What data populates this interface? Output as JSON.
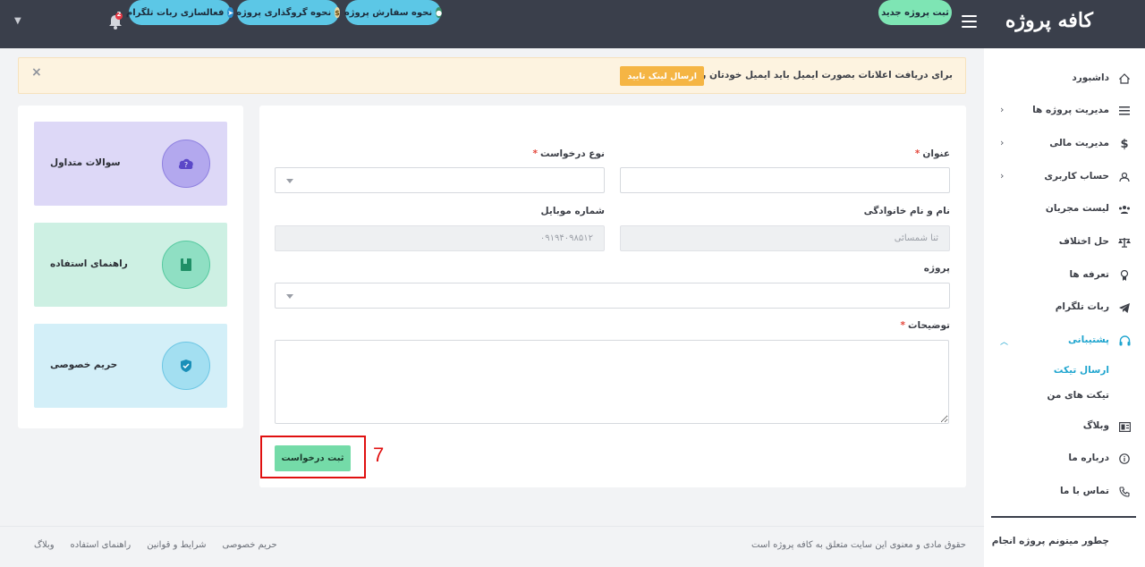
{
  "header": {
    "logo": "کافه پروژه",
    "new_project_label": "ثبت پروژه جدید",
    "how_to_order_label": "نحوه سفارش پروژه",
    "how_to_post_label": "نحوه گروگذاری پروژه",
    "telegram_bot_label": "فعالسازی ربات تلگرام",
    "notification_count": "2"
  },
  "alert": {
    "message": "برای دریافت اعلانات بصورت ایمیل باید ایمیل خودتان را تایید کنید.",
    "button_label": "ارسال لینک تایید",
    "close_symbol": "×"
  },
  "form": {
    "title_label": "عنوان",
    "type_label": "نوع درخواست",
    "name_label": "نام و نام خانوادگی",
    "name_value": "ثنا شمسائی",
    "mobile_label": "شماره موبایل",
    "mobile_value": "۰۹۱۹۴۰۹۸۵۱۲",
    "project_label": "پروژه",
    "description_label": "توضیحات",
    "required_mark": "*",
    "submit_label": "ثبت درخواست"
  },
  "annotation": {
    "number": "7",
    "color": "#e01010"
  },
  "widgets": [
    {
      "title": "سوالات متداول",
      "bg": "#ddd8f7",
      "circle": "#b3a8ee",
      "icon": "cloud-question-icon"
    },
    {
      "title": "راهنمای استفاده",
      "bg": "#cdf0e3",
      "circle": "#8fdfc3",
      "icon": "book-icon"
    },
    {
      "title": "حریم خصوصی",
      "bg": "#d3eff8",
      "circle": "#a3dff1",
      "icon": "shield-icon"
    }
  ],
  "sidebar": {
    "items": [
      {
        "label": "داشبورد",
        "icon": "home-icon"
      },
      {
        "label": "مدیریت پروژه ها",
        "icon": "list-icon",
        "expandable": true
      },
      {
        "label": "مدیریت مالی",
        "icon": "dollar-icon",
        "expandable": true
      },
      {
        "label": "حساب کاربری",
        "icon": "user-icon",
        "expandable": true
      },
      {
        "label": "لیست مجریان",
        "icon": "team-icon"
      },
      {
        "label": "حل اختلاف",
        "icon": "scale-icon"
      },
      {
        "label": "تعرفه ها",
        "icon": "tag-icon"
      },
      {
        "label": "ربات تلگرام",
        "icon": "telegram-icon"
      },
      {
        "label": "پشتیبانی",
        "icon": "headset-icon",
        "active": true
      },
      {
        "label": "وبلاگ",
        "icon": "blog-icon"
      },
      {
        "label": "درباره ما",
        "icon": "info-icon"
      },
      {
        "label": "تماس با ما",
        "icon": "phone-icon"
      }
    ],
    "sub_items": [
      "ارسال تیکت",
      "تیکت های من"
    ],
    "footer_text": "چطور میتونم پروژه انجام",
    "accent_color": "#1fa5cf"
  },
  "footer": {
    "copyright": "حقوق مادی و معنوی این سایت متعلق به کافه پروژه است",
    "links": [
      "وبلاگ",
      "راهنمای استفاده",
      "شرایط و قوانین",
      "حریم خصوصی"
    ]
  }
}
